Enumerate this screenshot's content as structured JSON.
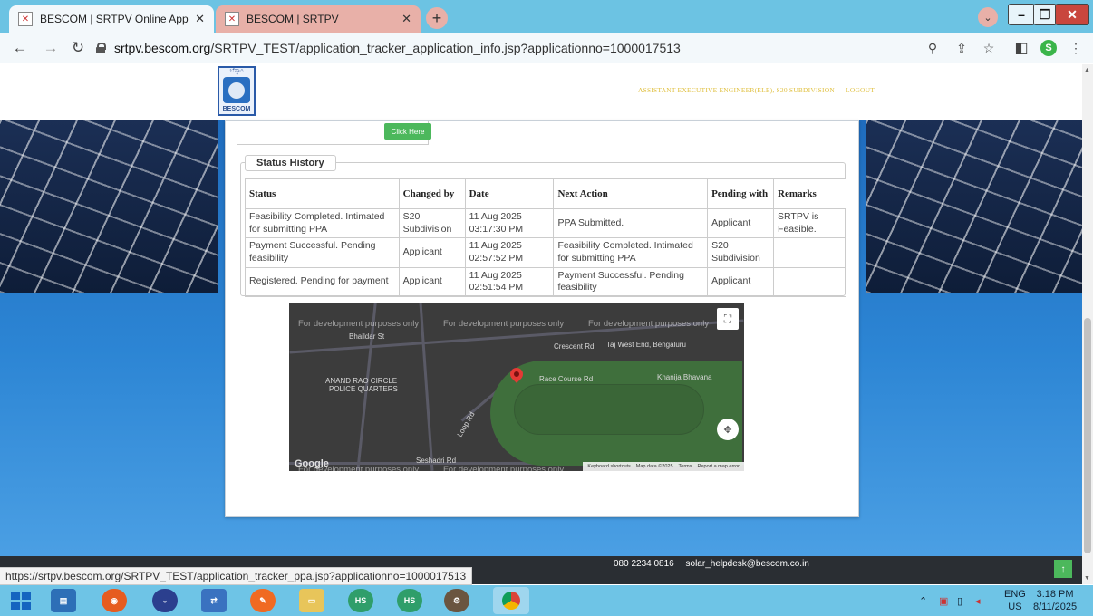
{
  "browser": {
    "tabs": [
      {
        "title": "BESCOM | SRTPV Online Applicat",
        "close": "✕"
      },
      {
        "title": "BESCOM | SRTPV",
        "close": "✕"
      }
    ],
    "new_tab": "+",
    "url_host": "srtpv.bescom.org",
    "url_path": "/SRTPV_TEST/application_tracker_application_info.jsp?applicationno=1000017513",
    "profile_initial": "S",
    "status_url": "https://srtpv.bescom.org/SRTPV_TEST/application_tracker_ppa.jsp?applicationno=1000017513"
  },
  "header": {
    "logo_text": "BESCOM",
    "logo_top_text": "ಬೆಸ್ಕಾಂ",
    "links": [
      "ASSISTANT EXECUTIVE ENGINEER(ELE), S20 SUBDIVISION",
      "LOGOUT"
    ]
  },
  "card": {
    "click_here": "Click Here",
    "legend": "Status History",
    "columns": [
      "Status",
      "Changed by",
      "Date",
      "Next Action",
      "Pending with",
      "Remarks"
    ],
    "rows": [
      [
        "Feasibility Completed. Intimated for submitting PPA",
        "S20 Subdivision",
        "11 Aug 2025 03:17:30 PM",
        "PPA Submitted.",
        "Applicant",
        "SRTPV is Feasible."
      ],
      [
        "Payment Successful. Pending feasibility",
        "Applicant",
        "11 Aug 2025 02:57:52 PM",
        "Feasibility Completed. Intimated for submitting PPA",
        "S20 Subdivision",
        ""
      ],
      [
        "Registered. Pending for payment",
        "Applicant",
        "11 Aug 2025 02:51:54 PM",
        "Payment Successful. Pending feasibility",
        "Applicant",
        ""
      ]
    ]
  },
  "map": {
    "dev_text": "For development purposes only",
    "labels": {
      "bhasdar": "Bhaildar St",
      "anand": "ANAND RAO CIRCLE",
      "police": "POLICE QUARTERS",
      "crescent": "Crescent Rd",
      "taj": "Taj West End, Bengaluru",
      "racecourse": "Race Course Rd",
      "khanija": "Khanija Bhavana",
      "seshadri": "Seshadri Rd",
      "loop": "Loop Rd"
    },
    "attribution": [
      "Keyboard shortcuts",
      "Map data ©2025",
      "Terms",
      "Report a map error"
    ],
    "google": "Google"
  },
  "footer": {
    "phone": "080 2234 0816",
    "email": "solar_helpdesk@bescom.co.in"
  },
  "taskbar": {
    "lang_top": "ENG",
    "lang_bottom": "US",
    "time": "3:18 PM",
    "date": "8/11/2025",
    "hs_label": "HS"
  }
}
